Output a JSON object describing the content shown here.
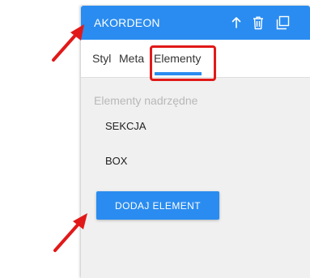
{
  "panel": {
    "title": "AKORDEON",
    "header_icons": [
      "arrow-up-icon",
      "trash-icon",
      "duplicate-icon"
    ],
    "accent_color": "#2a8cf0",
    "tabs": [
      {
        "label": "Styl",
        "active": false
      },
      {
        "label": "Meta",
        "active": false
      },
      {
        "label": "Elementy",
        "active": true
      }
    ],
    "section_label": "Elementy nadrzędne",
    "items": [
      "SEKCJA",
      "BOX"
    ],
    "add_button_label": "DODAJ ELEMENT"
  },
  "annotations": {
    "highlight_color": "#e11919",
    "arrow_icons": [
      "red-arrow-icon",
      "red-arrow-icon"
    ]
  }
}
